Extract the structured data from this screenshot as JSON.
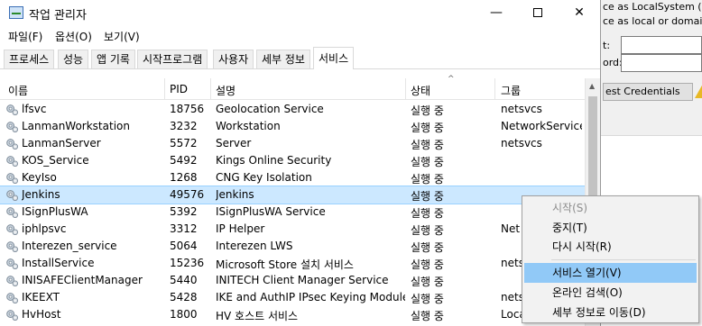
{
  "background_window": {
    "line1": "ce as LocalSystem (not",
    "line2": "ce as local or domain us",
    "label_user": "t:",
    "label_password": "ord:",
    "button": "est Credentials"
  },
  "window": {
    "title": "작업 관리자",
    "controls": {
      "minimize": "—",
      "close": "✕"
    }
  },
  "menu": [
    "파일(F)",
    "옵션(O)",
    "보기(V)"
  ],
  "tabs": [
    "프로세스",
    "성능",
    "앱 기록",
    "시작프로그램",
    "사용자",
    "세부 정보",
    "서비스"
  ],
  "active_tab": "서비스",
  "columns": [
    "이름",
    "PID",
    "설명",
    "상태",
    "그룹"
  ],
  "sort_indicator": "^",
  "rows": [
    {
      "name": "lfsvc",
      "pid": "18756",
      "desc": "Geolocation Service",
      "status": "실행 중",
      "group": "netsvcs"
    },
    {
      "name": "LanmanWorkstation",
      "pid": "3232",
      "desc": "Workstation",
      "status": "실행 중",
      "group": "NetworkService"
    },
    {
      "name": "LanmanServer",
      "pid": "5572",
      "desc": "Server",
      "status": "실행 중",
      "group": "netsvcs"
    },
    {
      "name": "KOS_Service",
      "pid": "5492",
      "desc": "Kings Online Security",
      "status": "실행 중",
      "group": ""
    },
    {
      "name": "KeyIso",
      "pid": "1268",
      "desc": "CNG Key Isolation",
      "status": "실행 중",
      "group": ""
    },
    {
      "name": "Jenkins",
      "pid": "49576",
      "desc": "Jenkins",
      "status": "실행 중",
      "group": ""
    },
    {
      "name": "ISignPlusWA",
      "pid": "5392",
      "desc": "ISignPlusWA Service",
      "status": "실행 중",
      "group": ""
    },
    {
      "name": "iphlpsvc",
      "pid": "3312",
      "desc": "IP Helper",
      "status": "실행 중",
      "group": "Net"
    },
    {
      "name": "Interezen_service",
      "pid": "5064",
      "desc": "Interezen LWS",
      "status": "실행 중",
      "group": ""
    },
    {
      "name": "InstallService",
      "pid": "15236",
      "desc": "Microsoft Store 설치 서비스",
      "status": "실행 중",
      "group": "nets"
    },
    {
      "name": "INISAFEClientManager",
      "pid": "5440",
      "desc": "INITECH Client Manager Service",
      "status": "실행 중",
      "group": ""
    },
    {
      "name": "IKEEXT",
      "pid": "5428",
      "desc": "IKE and AuthIP IPsec Keying Modules",
      "status": "실행 중",
      "group": "nets"
    },
    {
      "name": "HvHost",
      "pid": "1800",
      "desc": "HV 호스트 서비스",
      "status": "실행 중",
      "group": "Loca"
    }
  ],
  "selected_row": "Jenkins",
  "context_menu": {
    "items": [
      {
        "label": "시작(S)",
        "state": "disabled"
      },
      {
        "label": "중지(T)",
        "state": "normal"
      },
      {
        "label": "다시 시작(R)",
        "state": "normal"
      },
      {
        "label": "서비스 열기(V)",
        "state": "hover"
      },
      {
        "label": "온라인 검색(O)",
        "state": "normal"
      },
      {
        "label": "세부 정보로 이동(D)",
        "state": "normal"
      }
    ]
  },
  "colors": {
    "selection": "#cce8ff",
    "menu_hover": "#91c9f7",
    "warning": "#e8b825"
  },
  "icons": {
    "service": "gear-icon",
    "app": "task-manager-icon",
    "warning": "warning-icon"
  }
}
